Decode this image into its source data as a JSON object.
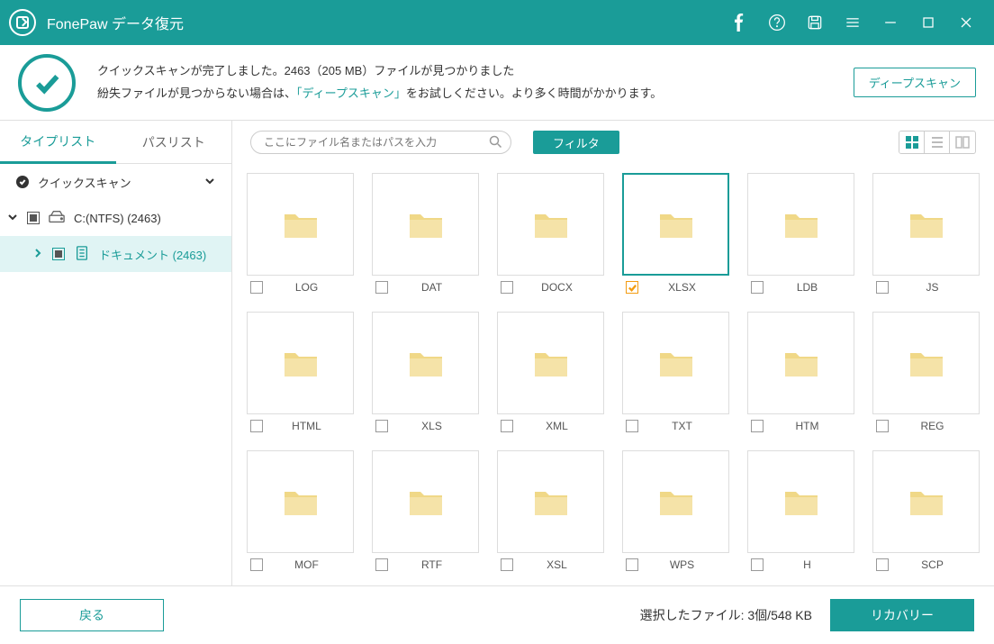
{
  "app_title": "FonePaw データ復元",
  "status": {
    "line1": "クイックスキャンが完了しました。2463（205 MB）ファイルが見つかりました",
    "line2_a": "紛失ファイルが見つからない場合は、",
    "line2_link": "「ディープスキャン」",
    "line2_b": "をお試しください。より多く時間がかかります。",
    "deep_scan_btn": "ディープスキャン"
  },
  "tabs": {
    "type_list": "タイプリスト",
    "path_list": "パスリスト"
  },
  "tree": {
    "quick_scan": "クイックスキャン",
    "drive": "C:(NTFS) (2463)",
    "documents": "ドキュメント (2463)"
  },
  "toolbar": {
    "search_placeholder": "ここにファイル名またはパスを入力",
    "filter": "フィルタ"
  },
  "folders": [
    {
      "name": "LOG",
      "checked": false,
      "selected": false
    },
    {
      "name": "DAT",
      "checked": false,
      "selected": false
    },
    {
      "name": "DOCX",
      "checked": false,
      "selected": false
    },
    {
      "name": "XLSX",
      "checked": true,
      "selected": true
    },
    {
      "name": "LDB",
      "checked": false,
      "selected": false
    },
    {
      "name": "JS",
      "checked": false,
      "selected": false
    },
    {
      "name": "HTML",
      "checked": false,
      "selected": false
    },
    {
      "name": "XLS",
      "checked": false,
      "selected": false
    },
    {
      "name": "XML",
      "checked": false,
      "selected": false
    },
    {
      "name": "TXT",
      "checked": false,
      "selected": false
    },
    {
      "name": "HTM",
      "checked": false,
      "selected": false
    },
    {
      "name": "REG",
      "checked": false,
      "selected": false
    },
    {
      "name": "MOF",
      "checked": false,
      "selected": false
    },
    {
      "name": "RTF",
      "checked": false,
      "selected": false
    },
    {
      "name": "XSL",
      "checked": false,
      "selected": false
    },
    {
      "name": "WPS",
      "checked": false,
      "selected": false
    },
    {
      "name": "H",
      "checked": false,
      "selected": false
    },
    {
      "name": "SCP",
      "checked": false,
      "selected": false
    }
  ],
  "footer": {
    "back": "戻る",
    "selected_label": "選択したファイル: 3個/548 KB",
    "recover": "リカバリー"
  }
}
